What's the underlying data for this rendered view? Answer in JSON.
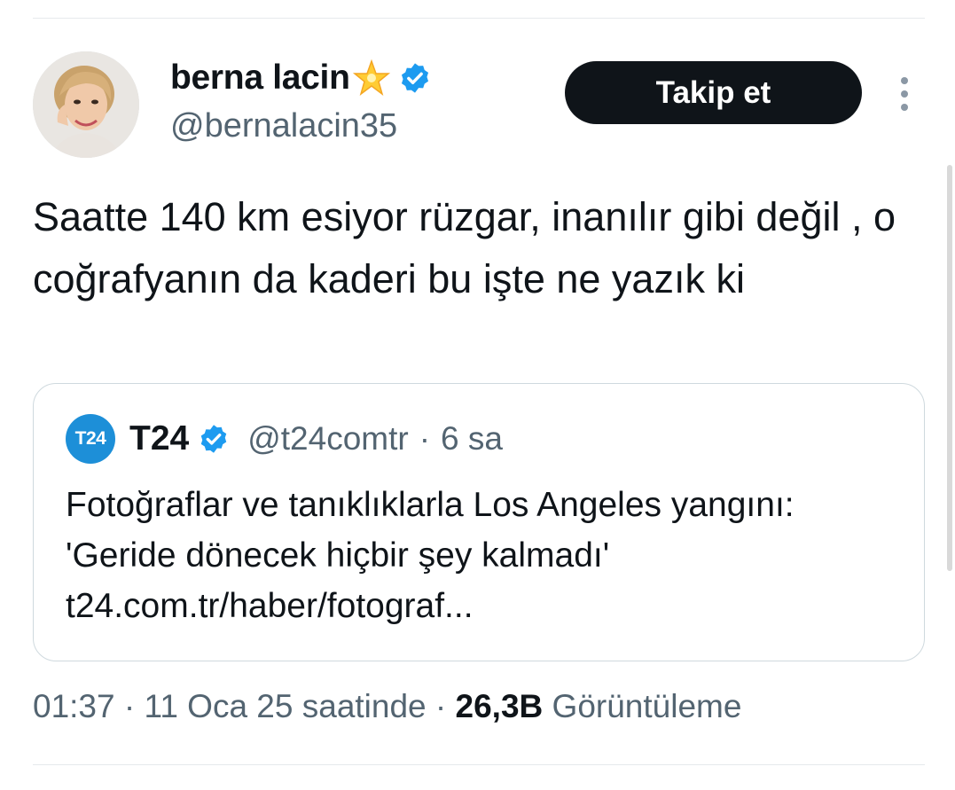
{
  "author": {
    "display_name": "berna lacin",
    "handle": "@bernalacin35",
    "avatar": "woman-portrait-avatar",
    "emoji": "glowing-star-icon",
    "verified": true
  },
  "follow_button": {
    "label": "Takip et"
  },
  "tweet": {
    "text": "Saatte 140 km esiyor rüzgar, inanılır gibi değil , o coğrafyanın da kaderi bu işte ne yazık ki"
  },
  "quote": {
    "logo_text": "T24",
    "name": "T24",
    "handle": "@t24comtr",
    "separator": "·",
    "time": "6 sa",
    "text": "Fotoğraflar ve tanıklıklarla Los Angeles yangını: 'Geride dönecek hiçbir şey kalmadı' t24.com.tr/haber/fotograf..."
  },
  "footer": {
    "time": "01:37",
    "dot1": "·",
    "date": "11 Oca 25 saatinde",
    "dot2": "·",
    "views_count": "26,3B",
    "views_label": "Görüntüleme"
  },
  "colors": {
    "verified_blue": "#1d9bf0",
    "muted_text": "#536471",
    "button_bg": "#0f1419",
    "border": "#cfd9de"
  }
}
